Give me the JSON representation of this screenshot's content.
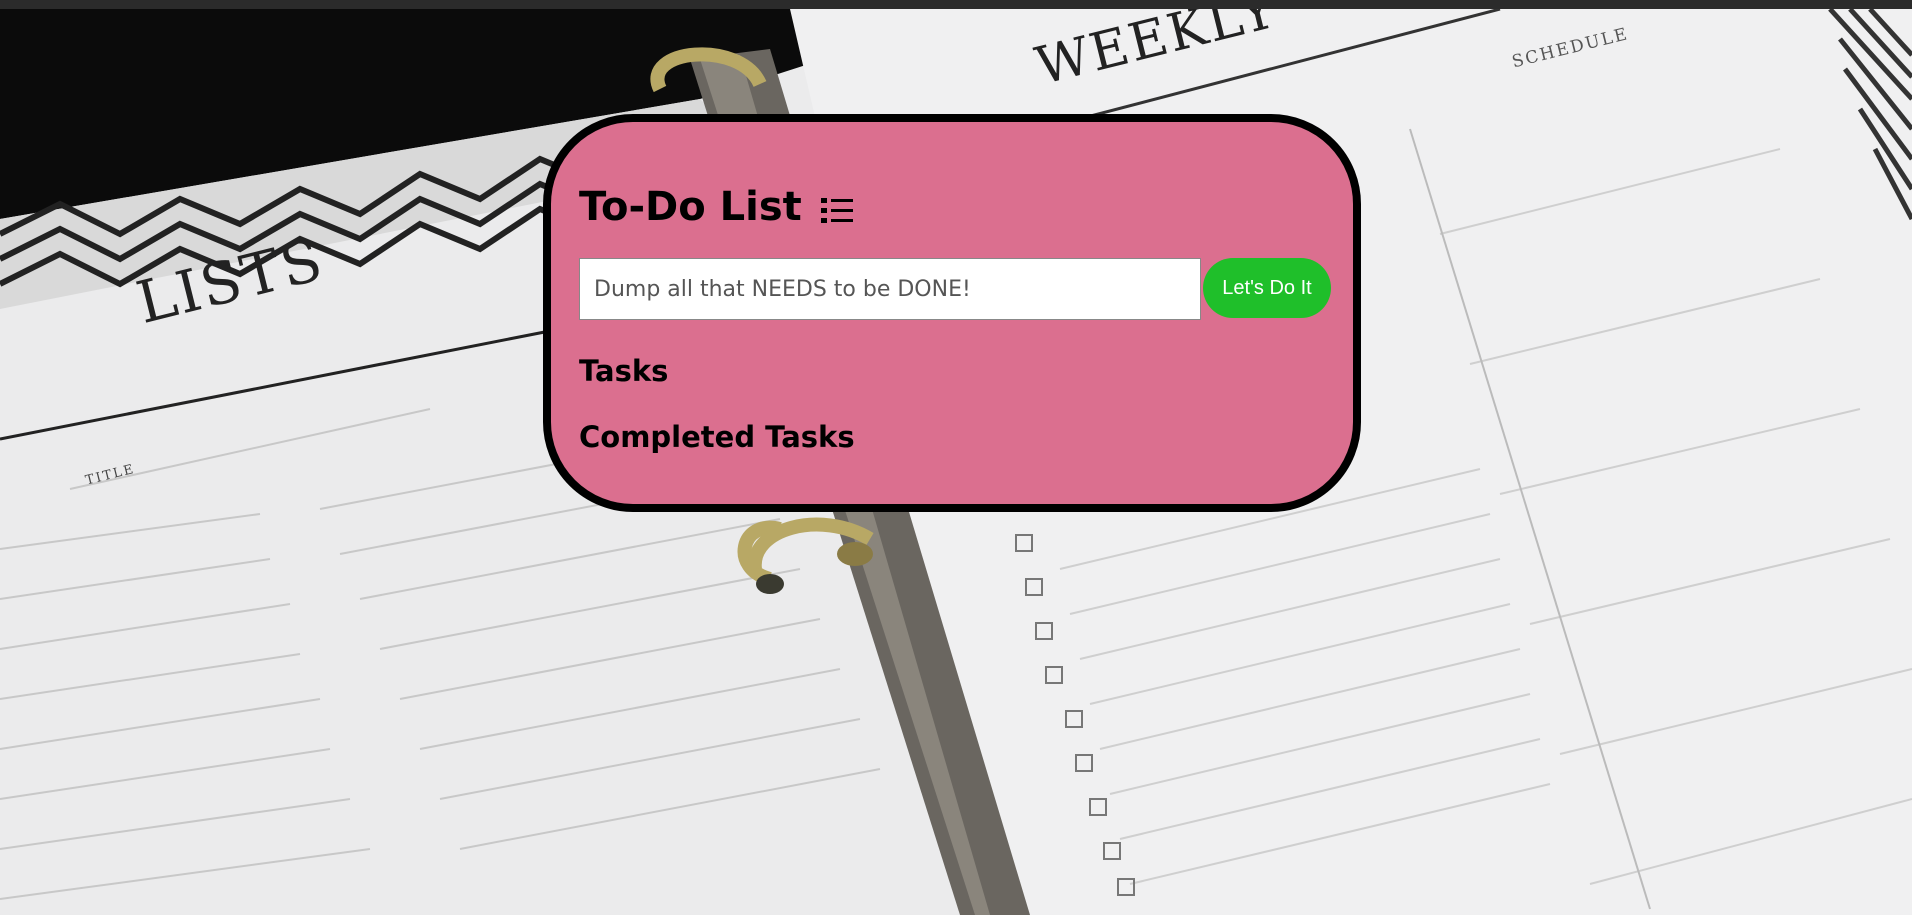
{
  "app": {
    "title": "To-Do List",
    "title_icon": "list-icon"
  },
  "input": {
    "placeholder": "Dump all that NEEDS to be DONE!",
    "value": ""
  },
  "add_button": {
    "label": "Let's Do It"
  },
  "sections": {
    "tasks_heading": "Tasks",
    "completed_heading": "Completed Tasks"
  },
  "tasks": [],
  "completed_tasks": [],
  "background": {
    "lists_label": "LISTS",
    "weekly_label": "WEEKLY",
    "schedule_label": "SCHEDULE",
    "title_label": "TITLE"
  },
  "colors": {
    "card_background": "#db6f8f",
    "card_border": "#000000",
    "button_background": "#1fbf2a",
    "button_text": "#ffffff"
  }
}
